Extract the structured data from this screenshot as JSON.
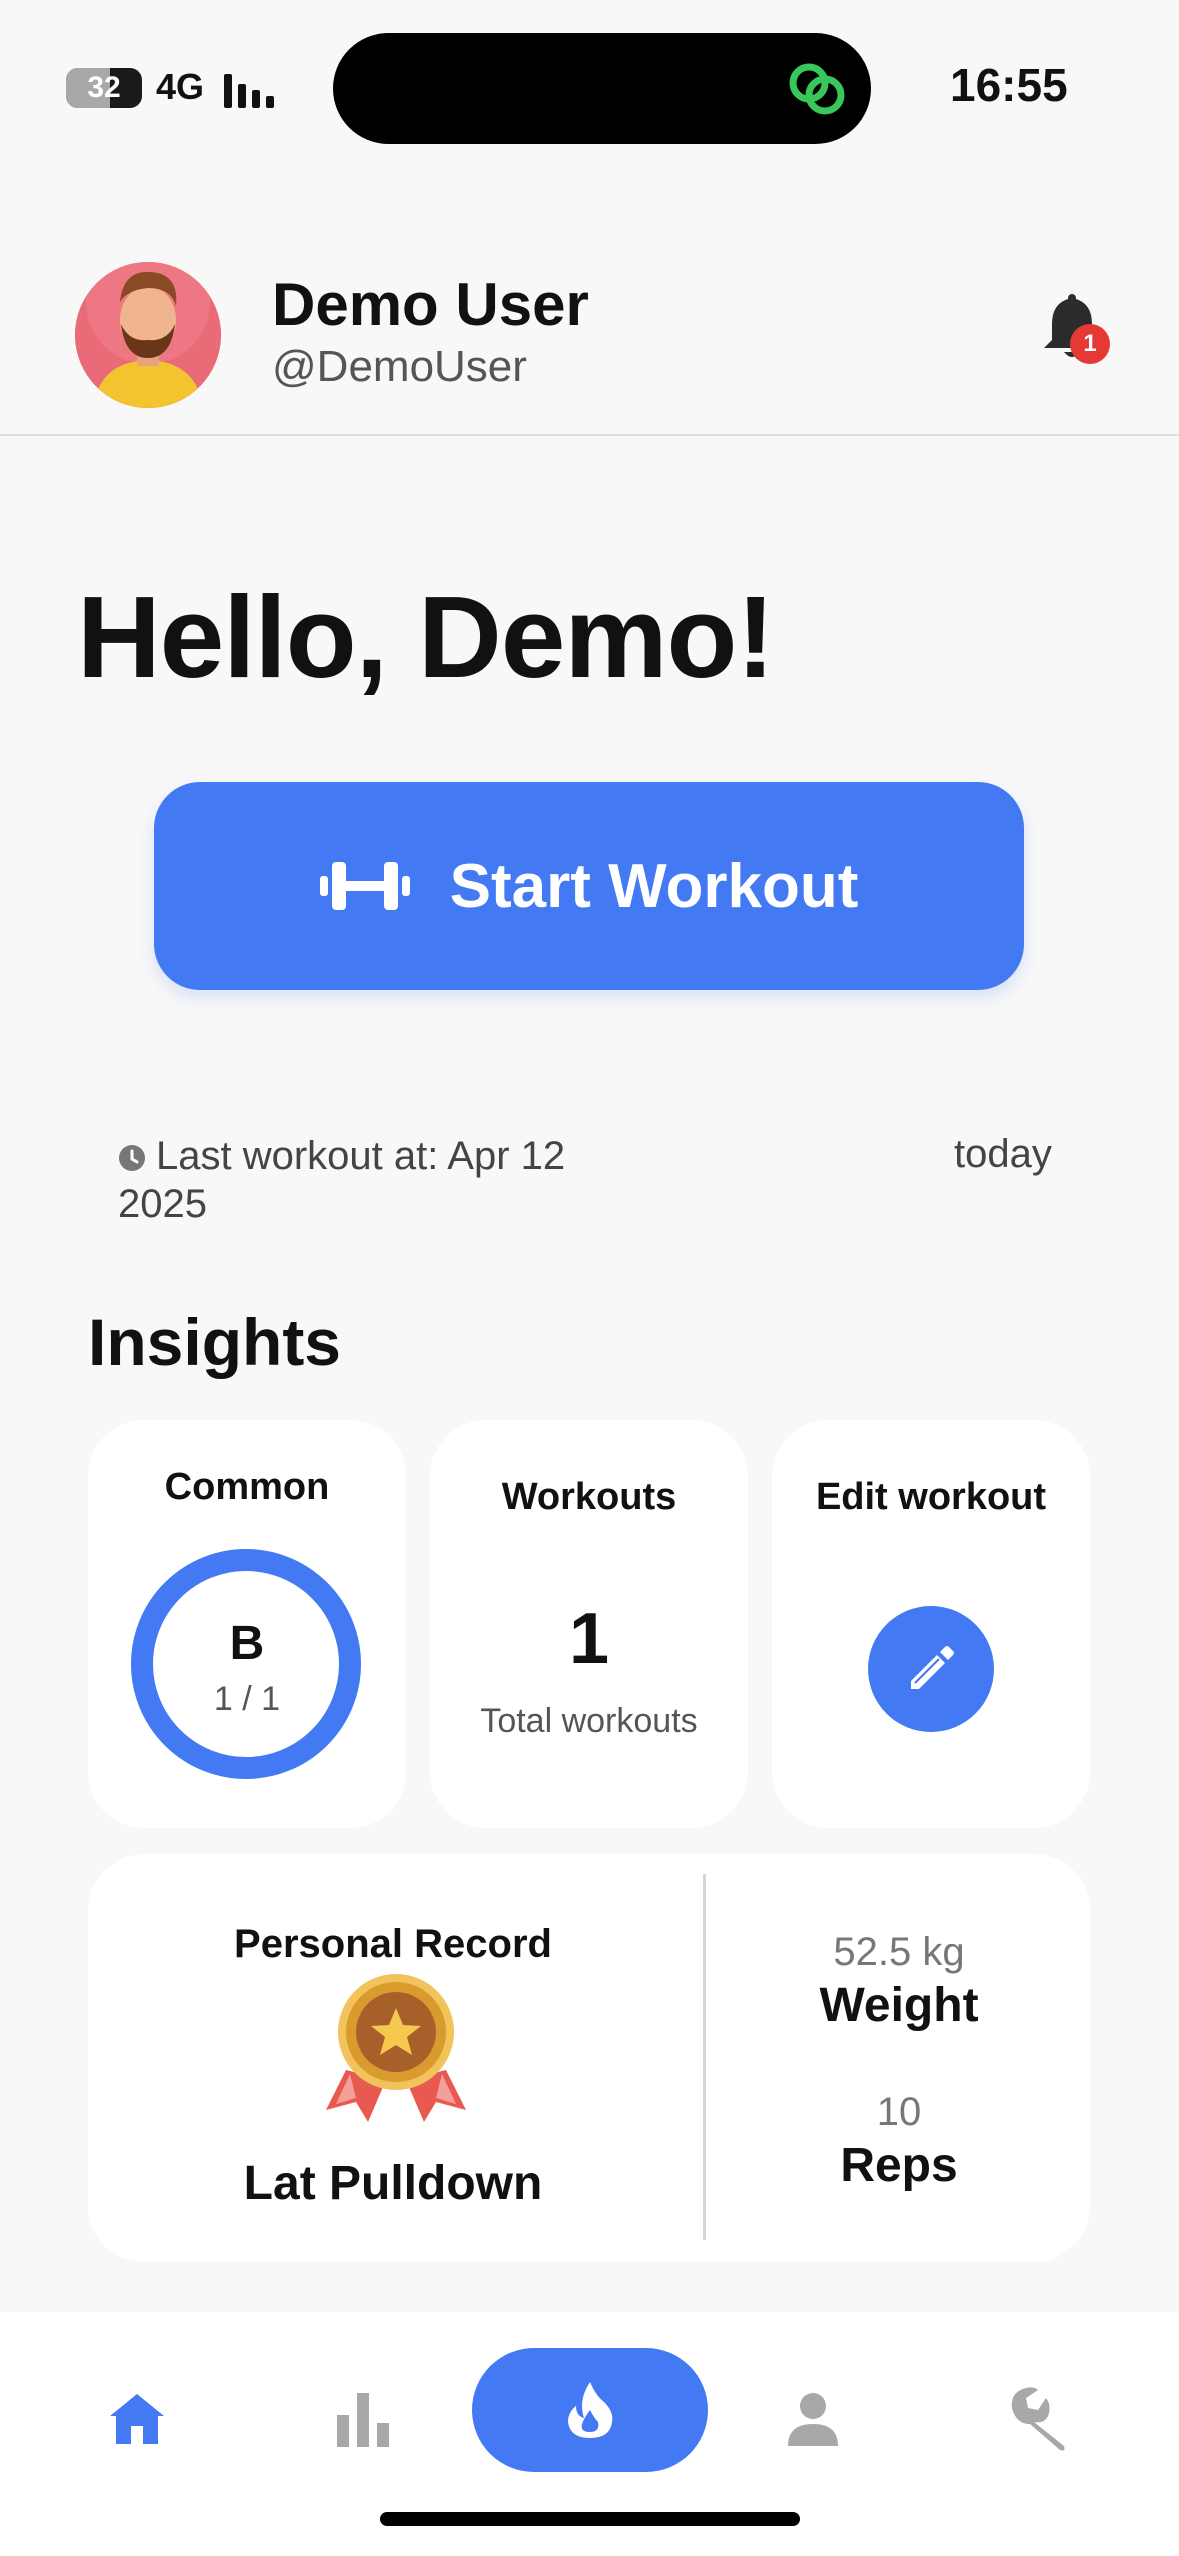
{
  "status_bar": {
    "battery": "32",
    "network": "4G",
    "time": "16:55"
  },
  "user": {
    "name": "Demo User",
    "handle": "@DemoUser",
    "notification_count": "1"
  },
  "greeting": "Hello, Demo!",
  "start_workout": {
    "label": "Start Workout"
  },
  "last_workout": {
    "text": "Last workout at: Apr 12 2025",
    "relative": "today"
  },
  "insights": {
    "title": "Insights",
    "common": {
      "title": "Common",
      "letter": "B",
      "ratio": "1 / 1",
      "progress": 1.0
    },
    "workouts": {
      "title": "Workouts",
      "count": "1",
      "label": "Total workouts"
    },
    "edit": {
      "title": "Edit workout"
    }
  },
  "personal_record": {
    "title": "Personal Record",
    "exercise": "Lat Pulldown",
    "weight_value": "52.5 kg",
    "weight_label": "Weight",
    "reps_value": "10",
    "reps_label": "Reps"
  },
  "nav": {
    "items": [
      {
        "icon": "home-icon",
        "active": true
      },
      {
        "icon": "stats-icon",
        "active": false
      },
      {
        "icon": "flame-icon",
        "active": false
      },
      {
        "icon": "profile-icon",
        "active": false
      },
      {
        "icon": "wrench-icon",
        "active": false
      }
    ]
  },
  "colors": {
    "accent": "#4379f2",
    "badge": "#e53935",
    "inactive_icon": "#a8a8a8",
    "background": "#f8f8f8"
  }
}
